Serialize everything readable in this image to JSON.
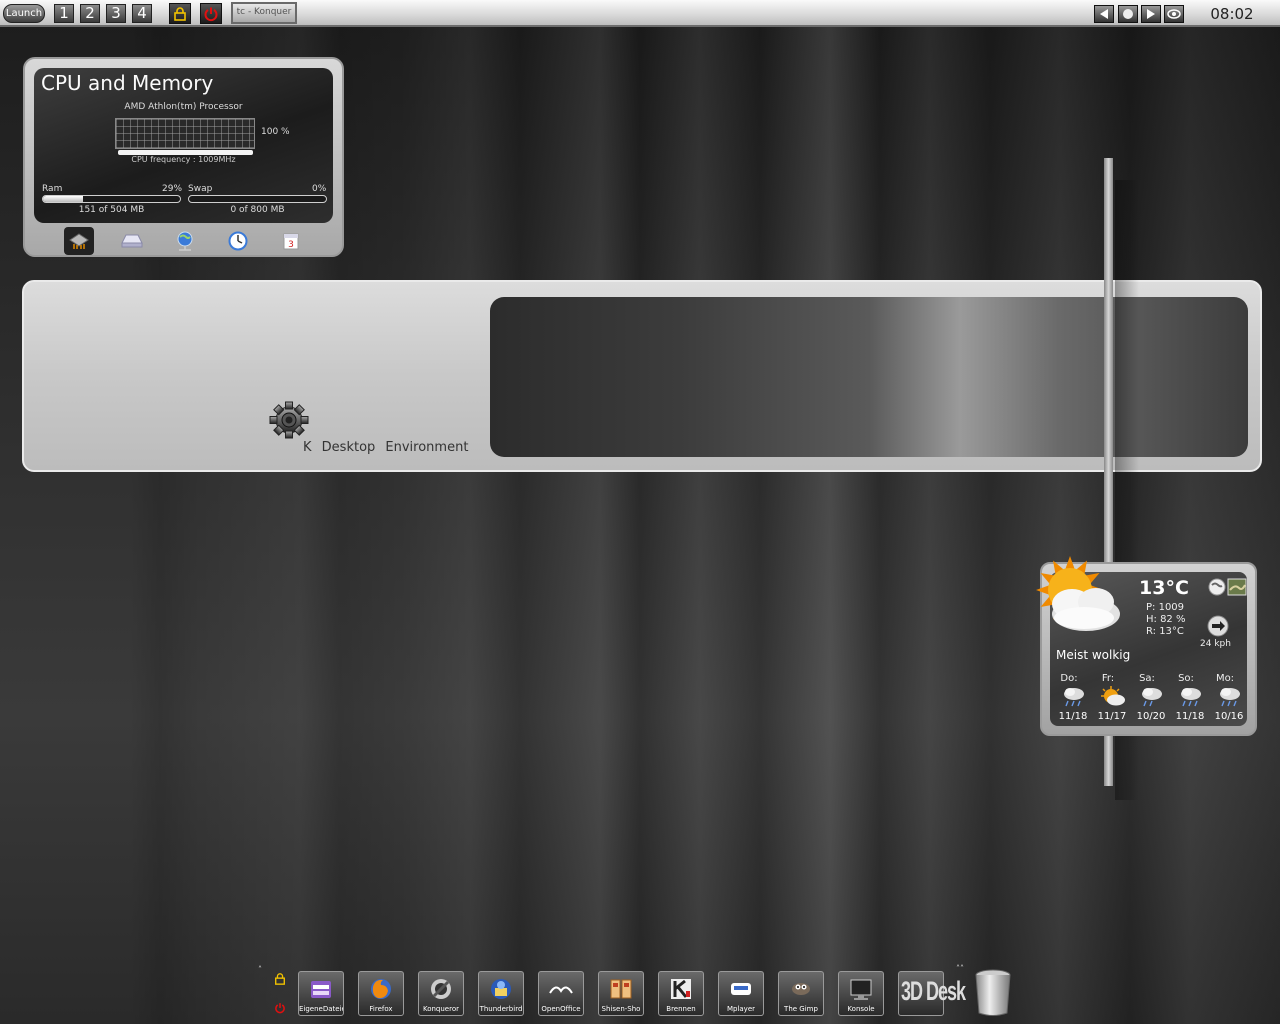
{
  "top_panel": {
    "launch_label": "Launch",
    "desktops": [
      "1",
      "2",
      "3",
      "4"
    ],
    "task_title": "tc - Konquer",
    "clock": "08:02"
  },
  "cpu_widget": {
    "title": "CPU and Memory",
    "processor": "AMD Athlon(tm) Processor",
    "cpu_load_label": "100 %",
    "cpu_frequency": "CPU frequency : 1009MHz",
    "ram": {
      "label": "Ram",
      "percent_label": "29%",
      "usage": "151 of 504 MB",
      "fill": 0.29
    },
    "swap": {
      "label": "Swap",
      "percent_label": "0%",
      "usage": "0 of 800 MB",
      "fill": 0.0
    },
    "tabs": [
      "cpu-chip-icon",
      "hard-drive-icon",
      "network-icon",
      "clock-icon",
      "calendar-icon"
    ],
    "calendar_day": "3"
  },
  "kde_banner": {
    "text": "K Desktop Environment"
  },
  "weather": {
    "temperature": "13°C",
    "pressure": "P: 1009",
    "humidity": "H: 82 %",
    "real_feel": "R: 13°C",
    "wind": "24 kph",
    "condition": "Meist wolkig",
    "forecast": [
      {
        "day": "Do:",
        "temps": "11/18",
        "icon": "rain-cloud-icon"
      },
      {
        "day": "Fr:",
        "temps": "11/17",
        "icon": "sun-cloud-icon"
      },
      {
        "day": "Sa:",
        "temps": "10/20",
        "icon": "rain-cloud-icon"
      },
      {
        "day": "So:",
        "temps": "11/18",
        "icon": "rain-cloud-icon"
      },
      {
        "day": "Mo:",
        "temps": "10/16",
        "icon": "rain-cloud-icon"
      }
    ]
  },
  "dock": {
    "items": [
      {
        "label": "EigeneDateien",
        "icon": "home-folder-icon"
      },
      {
        "label": "Firefox",
        "icon": "firefox-icon"
      },
      {
        "label": "Konqueror",
        "icon": "konqueror-icon"
      },
      {
        "label": "Thunderbird",
        "icon": "thunderbird-icon"
      },
      {
        "label": "OpenOffice",
        "icon": "openoffice-icon"
      },
      {
        "label": "Shisen-Sho",
        "icon": "shisen-sho-icon"
      },
      {
        "label": "Brennen",
        "icon": "k3b-burn-icon"
      },
      {
        "label": "Mplayer",
        "icon": "mplayer-icon"
      },
      {
        "label": "The Gimp",
        "icon": "gimp-icon"
      },
      {
        "label": "Konsole",
        "icon": "konsole-icon"
      },
      {
        "label": "",
        "icon": "3d-desktop-icon",
        "logo_text": "3D Desk"
      }
    ]
  }
}
